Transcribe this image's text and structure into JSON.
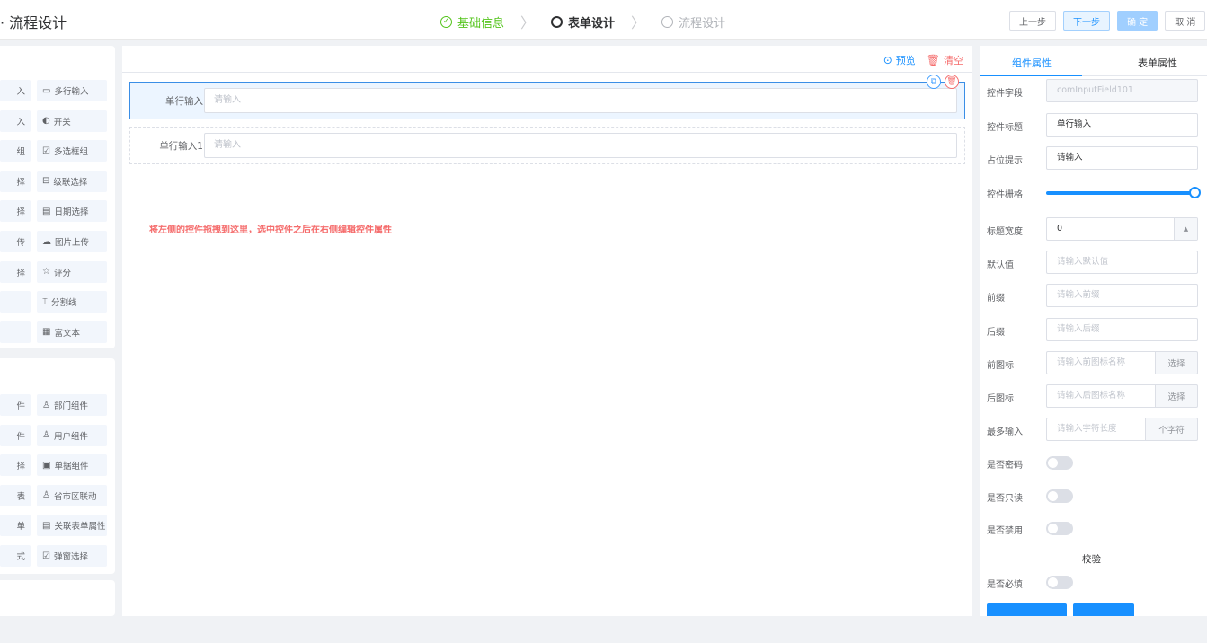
{
  "header": {
    "title": "· 流程设计",
    "steps": [
      {
        "label": "基础信息",
        "state": "done"
      },
      {
        "label": "表单设计",
        "state": "active"
      },
      {
        "label": "流程设计",
        "state": "todo"
      }
    ],
    "buttons": {
      "prev": "上一步",
      "next": "下一步",
      "confirm": "确 定",
      "cancel": "取 消"
    }
  },
  "left_panel": {
    "group1": [
      [
        "入",
        "多行输入"
      ],
      [
        "入",
        "开关"
      ],
      [
        "组",
        "多选框组"
      ],
      [
        "择",
        "级联选择"
      ],
      [
        "择",
        "日期选择"
      ],
      [
        "传",
        "图片上传"
      ],
      [
        "择",
        "评分"
      ],
      [
        "",
        "分割线"
      ],
      [
        "",
        "富文本"
      ]
    ],
    "group1_icons": [
      "textarea-icon",
      "switch-icon",
      "checkbox-icon",
      "cascader-icon",
      "calendar-icon",
      "upload-icon",
      "star-icon",
      "divider-icon",
      "richtext-icon"
    ],
    "group1_glyphs": [
      "▭",
      "◐",
      "☑",
      "⊟",
      "▤",
      "☁",
      "☆",
      "⌶",
      "▦"
    ],
    "group2": [
      [
        "件",
        "部门组件"
      ],
      [
        "件",
        "用户组件"
      ],
      [
        "择",
        "单据组件"
      ],
      [
        "表",
        "省市区联动"
      ],
      [
        "单",
        "关联表单属性"
      ],
      [
        "式",
        "弹窗选择"
      ]
    ],
    "group2_icons": [
      "department-icon",
      "user-icon",
      "document-icon",
      "region-icon",
      "link-form-icon",
      "popup-select-icon"
    ],
    "group2_glyphs": [
      "♙",
      "♙",
      "▣",
      "♙",
      "▤",
      "☑"
    ]
  },
  "canvas": {
    "toolbar": {
      "preview": "预览",
      "clear": "清空"
    },
    "fields": [
      {
        "label": "单行输入",
        "placeholder": "请输入"
      },
      {
        "label": "单行输入1",
        "placeholder": "请输入"
      }
    ],
    "hint": "将左侧的控件拖拽到这里，选中控件之后在右侧编辑控件属性"
  },
  "right_panel": {
    "tabs": [
      "组件属性",
      "表单属性"
    ],
    "props": {
      "field": {
        "label": "控件字段",
        "value": "comInputField101"
      },
      "title": {
        "label": "控件标题",
        "value": "单行输入"
      },
      "placeholder": {
        "label": "占位提示",
        "value": "请输入"
      },
      "grid": {
        "label": "控件栅格",
        "value": 1.0
      },
      "label_width": {
        "label": "标题宽度",
        "value": "0"
      },
      "default": {
        "label": "默认值",
        "placeholder": "请输入默认值"
      },
      "prefix": {
        "label": "前缀",
        "placeholder": "请输入前缀"
      },
      "suffix": {
        "label": "后缀",
        "placeholder": "请输入后缀"
      },
      "prefix_icon": {
        "label": "前图标",
        "placeholder": "请输入前图标名称",
        "button": "选择"
      },
      "suffix_icon": {
        "label": "后图标",
        "placeholder": "请输入后图标名称",
        "button": "选择"
      },
      "maxlength": {
        "label": "最多输入",
        "placeholder": "请输入字符长度",
        "addon": "个字符"
      },
      "password": {
        "label": "是否密码",
        "on": false
      },
      "readonly": {
        "label": "是否只读",
        "on": false
      },
      "disabled": {
        "label": "是否禁用",
        "on": false
      },
      "section": "校验",
      "required": {
        "label": "是否必填",
        "on": false
      }
    }
  }
}
